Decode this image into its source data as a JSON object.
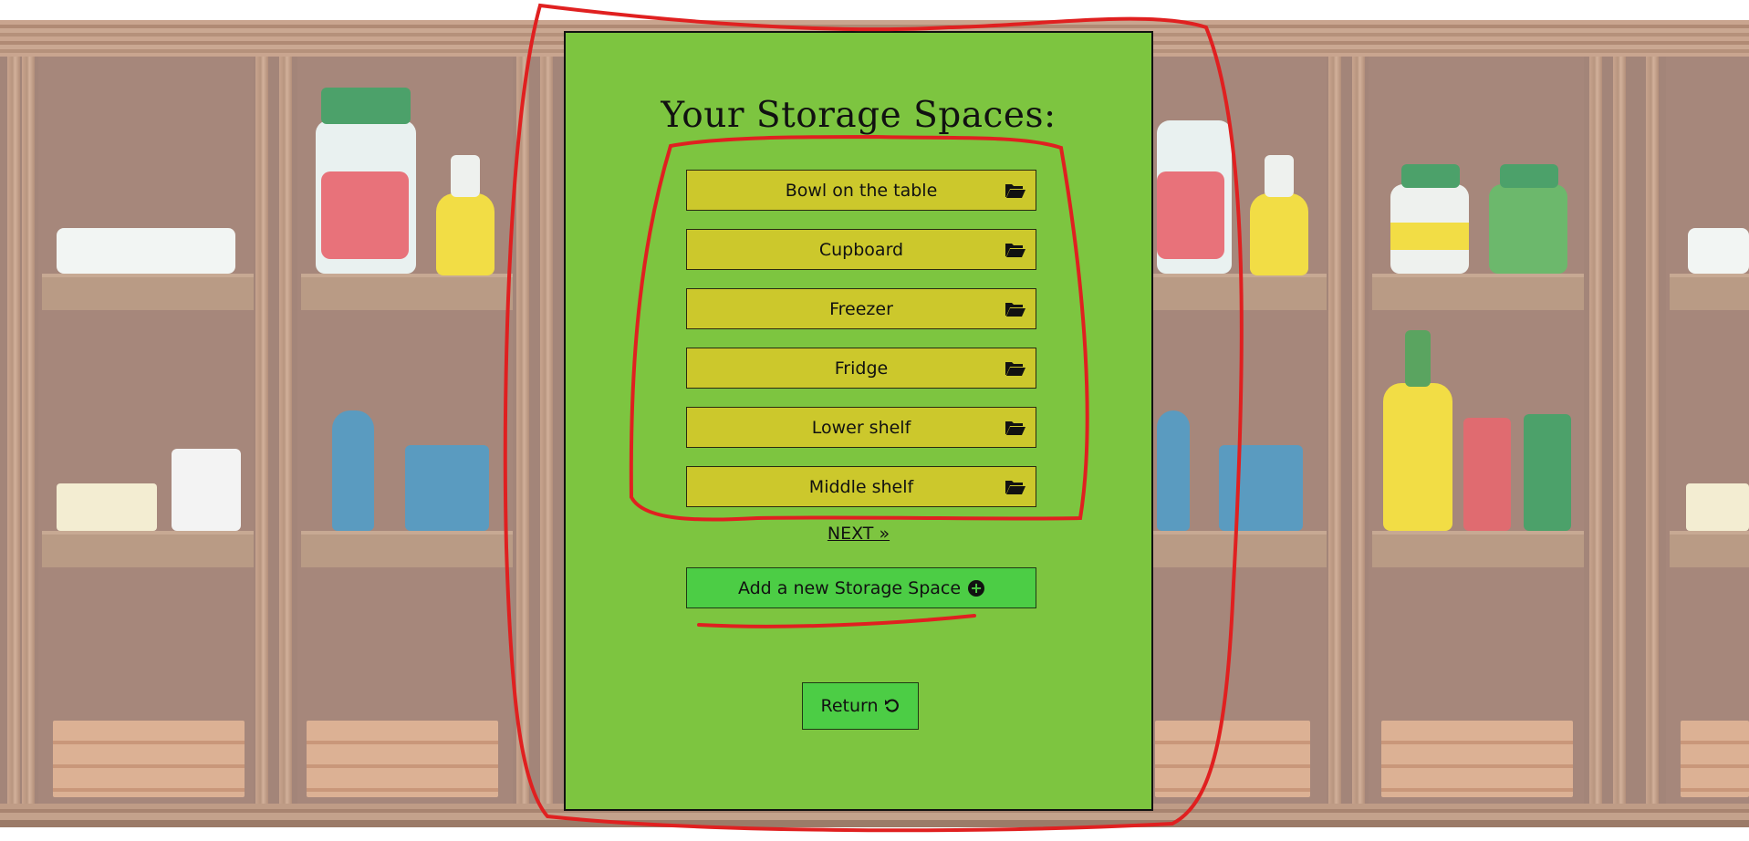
{
  "title": "Your Storage Spaces:",
  "storage_spaces": [
    {
      "label": "Bowl on the table",
      "icon": "folder-open-icon"
    },
    {
      "label": "Cupboard",
      "icon": "folder-open-icon"
    },
    {
      "label": "Freezer",
      "icon": "folder-open-icon"
    },
    {
      "label": "Fridge",
      "icon": "folder-open-icon"
    },
    {
      "label": "Lower shelf",
      "icon": "folder-open-icon"
    },
    {
      "label": "Middle shelf",
      "icon": "folder-open-icon"
    }
  ],
  "next_link": "NEXT »",
  "add_button": {
    "label": "Add a new Storage Space",
    "icon": "plus-circle-icon"
  },
  "return_button": {
    "label": "Return",
    "icon": "undo-icon"
  },
  "colors": {
    "modal_bg": "#7dc540",
    "item_bg": "#ccc82c",
    "action_bg": "#4ccd45",
    "annotation": "#e02020"
  }
}
